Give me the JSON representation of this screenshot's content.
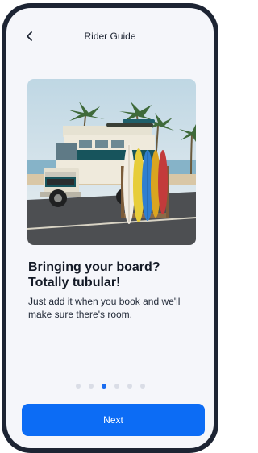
{
  "header": {
    "title": "Rider Guide",
    "back_icon": "chevron-left-icon"
  },
  "image": {
    "subject": "shuttle-van-with-surfboards-photo"
  },
  "content": {
    "heading_line1": "Bringing your board?",
    "heading_line2": "Totally tubular!",
    "body": "Just add it when you book and we'll make sure there's room."
  },
  "pagination": {
    "total": 6,
    "current": 3
  },
  "footer": {
    "next_label": "Next"
  },
  "colors": {
    "accent": "#0c6cf5",
    "background": "#f5f6fa",
    "device_frame": "#1d2433",
    "dot_inactive": "#dadde6"
  }
}
